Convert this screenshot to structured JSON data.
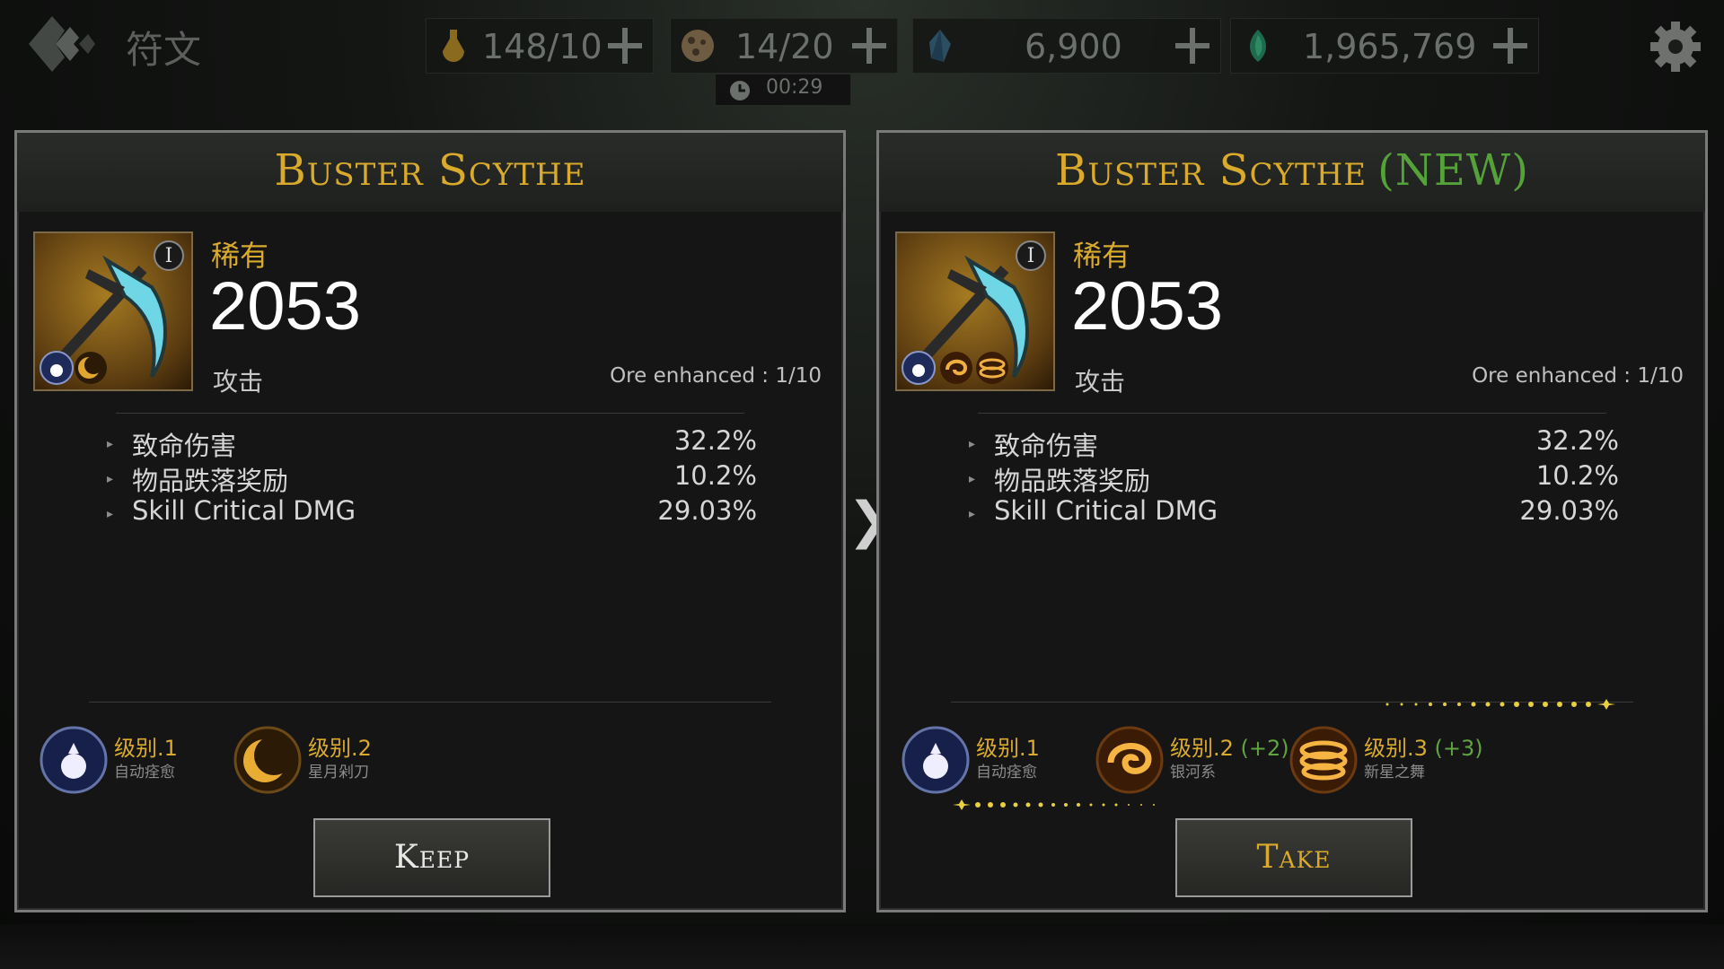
{
  "topbar": {
    "screen_title": "符文",
    "resources": [
      {
        "icon": "potion-icon",
        "value": "148/10"
      },
      {
        "icon": "ore-icon",
        "value": "14/20"
      },
      {
        "icon": "crystal-icon",
        "value": "6,900"
      },
      {
        "icon": "soul-gem-icon",
        "value": "1,965,769"
      }
    ],
    "timer": "00:29"
  },
  "compare_arrow": "❯",
  "current": {
    "name": "Buster Scythe",
    "rarity": "稀有",
    "power": "2053",
    "stat_type": "攻击",
    "ore_enhanced": "Ore enhanced : 1/10",
    "rank": "I",
    "stats": [
      {
        "name": "致命伤害",
        "value": "32.2%"
      },
      {
        "name": "物品跌落奖励",
        "value": "10.2%"
      },
      {
        "name": "Skill Critical DMG",
        "value": "29.03%"
      }
    ],
    "skills": [
      {
        "level": "级别.1",
        "name": "自动痊愈",
        "icon": "heal-orb-icon"
      },
      {
        "level": "级别.2",
        "name": "星月剁刀",
        "icon": "crescent-moon-icon"
      }
    ],
    "button": "Keep"
  },
  "new": {
    "name": "Buster Scythe",
    "new_tag": "(NEW)",
    "rarity": "稀有",
    "power": "2053",
    "stat_type": "攻击",
    "ore_enhanced": "Ore enhanced : 1/10",
    "rank": "I",
    "stats": [
      {
        "name": "致命伤害",
        "value": "32.2%"
      },
      {
        "name": "物品跌落奖励",
        "value": "10.2%"
      },
      {
        "name": "Skill Critical DMG",
        "value": "29.03%"
      }
    ],
    "skills": [
      {
        "level": "级别.1",
        "bonus": "",
        "name": "自动痊愈",
        "icon": "heal-orb-icon"
      },
      {
        "level": "级别.2",
        "bonus": "(+2)",
        "name": "银河系",
        "icon": "galaxy-swirl-icon"
      },
      {
        "level": "级别.3",
        "bonus": "(+3)",
        "name": "新星之舞",
        "icon": "nova-dance-icon"
      }
    ],
    "button": "Take"
  },
  "colors": {
    "gold": "#d9aa2c",
    "green": "#55a23a"
  }
}
